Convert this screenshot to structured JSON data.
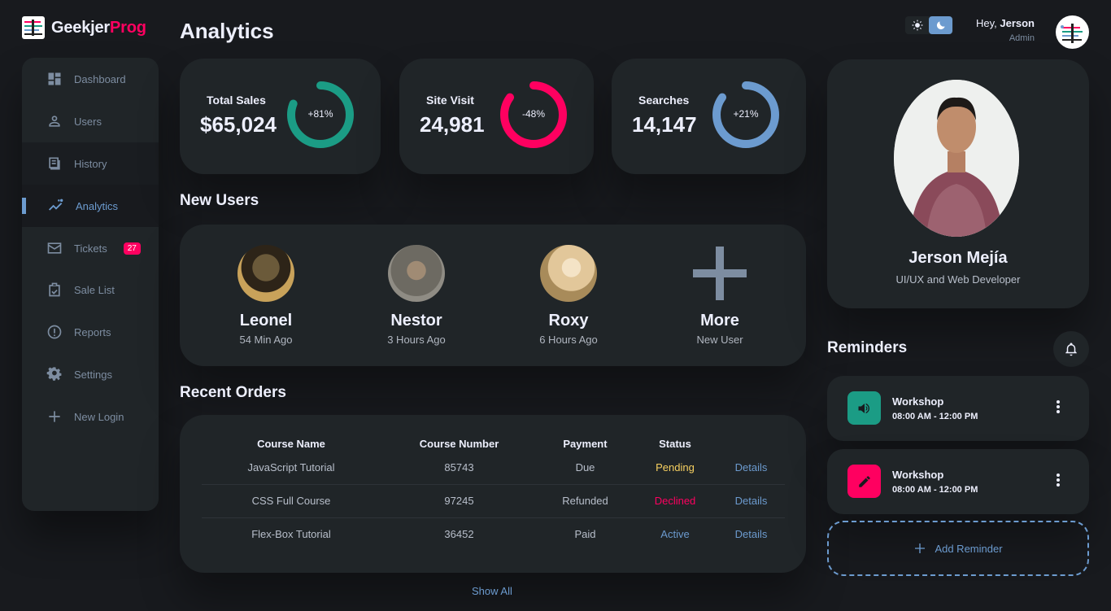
{
  "brand": {
    "name_a": "Geekjer",
    "name_b": "Prog"
  },
  "sidebar": {
    "items": [
      {
        "label": "Dashboard",
        "icon": "dashboard-icon"
      },
      {
        "label": "Users",
        "icon": "user-icon"
      },
      {
        "label": "History",
        "icon": "history-icon"
      },
      {
        "label": "Analytics",
        "icon": "analytics-icon",
        "active": true
      },
      {
        "label": "Tickets",
        "icon": "mail-icon",
        "badge": "27"
      },
      {
        "label": "Sale List",
        "icon": "clipboard-icon"
      },
      {
        "label": "Reports",
        "icon": "report-icon"
      },
      {
        "label": "Settings",
        "icon": "gear-icon"
      },
      {
        "label": "New Login",
        "icon": "plus-icon"
      }
    ]
  },
  "page": {
    "title": "Analytics"
  },
  "stats": [
    {
      "label": "Total Sales",
      "value": "$65,024",
      "percent": "+81%",
      "fraction": 0.81,
      "color": "#1b9c85"
    },
    {
      "label": "Site Visit",
      "value": "24,981",
      "percent": "-48%",
      "fraction": 0.85,
      "color": "#ff0060"
    },
    {
      "label": "Searches",
      "value": "14,147",
      "percent": "+21%",
      "fraction": 0.85,
      "color": "#6c9bcf"
    }
  ],
  "new_users": {
    "title": "New Users",
    "users": [
      {
        "name": "Leonel",
        "time": "54 Min Ago"
      },
      {
        "name": "Nestor",
        "time": "3 Hours Ago"
      },
      {
        "name": "Roxy",
        "time": "6 Hours Ago"
      },
      {
        "name": "More",
        "time": "New User"
      }
    ]
  },
  "orders": {
    "title": "Recent Orders",
    "columns": [
      "Course Name",
      "Course Number",
      "Payment",
      "Status",
      ""
    ],
    "rows": [
      {
        "name": "JavaScript Tutorial",
        "number": "85743",
        "payment": "Due",
        "status": "Pending",
        "details": "Details"
      },
      {
        "name": "CSS Full Course",
        "number": "97245",
        "payment": "Refunded",
        "status": "Declined",
        "details": "Details"
      },
      {
        "name": "Flex-Box Tutorial",
        "number": "36452",
        "payment": "Paid",
        "status": "Active",
        "details": "Details"
      }
    ],
    "show_all": "Show All"
  },
  "header": {
    "greeting": "Hey,",
    "username": "Jerson",
    "role": "Admin"
  },
  "profile": {
    "name": "Jerson Mejía",
    "title": "UI/UX and Web Developer"
  },
  "reminders": {
    "title": "Reminders",
    "items": [
      {
        "title": "Workshop",
        "time": "08:00 AM - 12:00 PM",
        "icon": "volume-icon",
        "color": "#1b9c85"
      },
      {
        "title": "Workshop",
        "time": "08:00 AM - 12:00 PM",
        "icon": "edit-icon",
        "color": "#ff0060"
      }
    ],
    "add_label": "Add Reminder"
  }
}
